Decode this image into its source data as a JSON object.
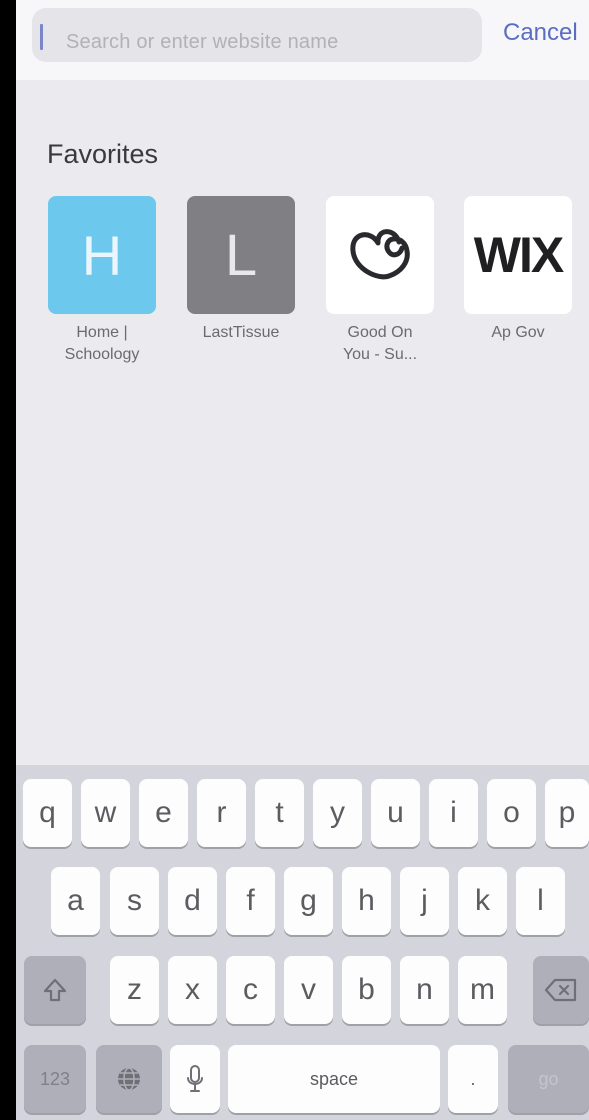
{
  "search": {
    "placeholder": "Search or enter website name",
    "cancel_label": "Cancel"
  },
  "favorites": {
    "heading": "Favorites",
    "items": [
      {
        "icon_letter": "H",
        "label_line1": "Home |",
        "label_line2": "Schoology",
        "color": "#6cc8ec"
      },
      {
        "icon_letter": "L",
        "label_line1": "LastTissue",
        "label_line2": "",
        "color": "#7f7f84"
      },
      {
        "icon": "good-on-you-logo",
        "label_line1": "Good On",
        "label_line2": "You - Su...",
        "color": "#ffffff"
      },
      {
        "icon_text": "WIX",
        "label_line1": "Ap Gov",
        "label_line2": "",
        "color": "#ffffff"
      }
    ]
  },
  "keyboard": {
    "row1": [
      "q",
      "w",
      "e",
      "r",
      "t",
      "y",
      "u",
      "i",
      "o",
      "p"
    ],
    "row2": [
      "a",
      "s",
      "d",
      "f",
      "g",
      "h",
      "j",
      "k",
      "l"
    ],
    "row3": [
      "z",
      "x",
      "c",
      "v",
      "b",
      "n",
      "m"
    ],
    "numbers_label": "123",
    "space_label": "space",
    "period_label": ".",
    "go_label": "go",
    "icons": [
      "shift-icon",
      "delete-icon",
      "globe-icon",
      "microphone-icon"
    ]
  }
}
